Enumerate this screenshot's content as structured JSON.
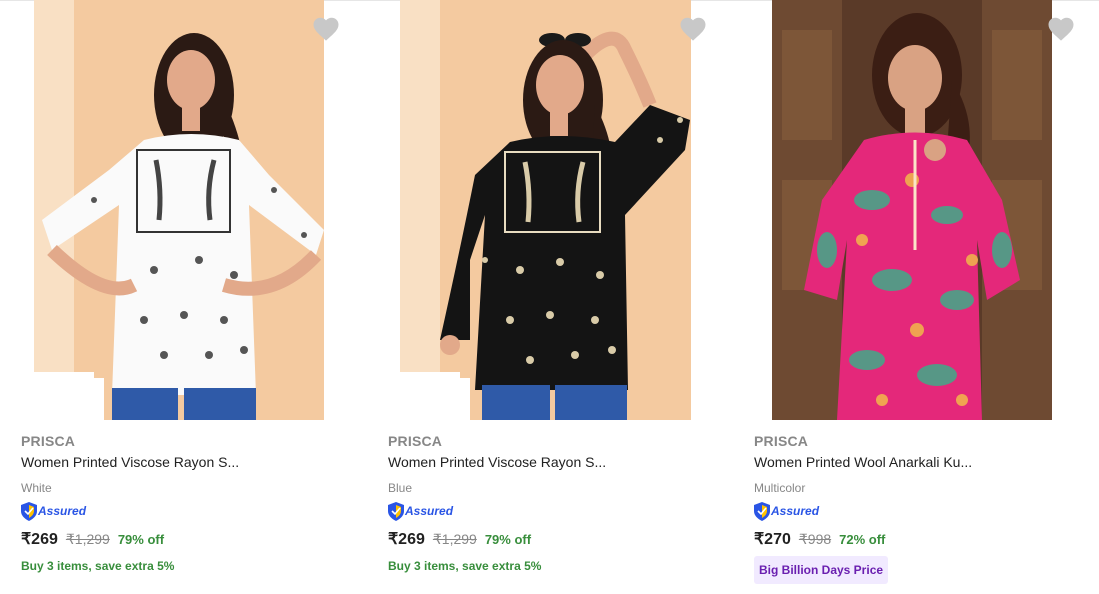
{
  "products": [
    {
      "brand": "PRISCA",
      "title": "Women Printed Viscose Rayon S...",
      "color": "White",
      "assured_label": "Assured",
      "price": "₹269",
      "mrp": "₹1,299",
      "discount": "79% off",
      "offer": "Buy 3 items, save extra 5%",
      "wishlist_icon": "heart-icon",
      "image_desc": "woman-in-white-embroidered-top"
    },
    {
      "brand": "PRISCA",
      "title": "Women Printed Viscose Rayon S...",
      "color": "Blue",
      "assured_label": "Assured",
      "price": "₹269",
      "mrp": "₹1,299",
      "discount": "79% off",
      "offer": "Buy 3 items, save extra 5%",
      "wishlist_icon": "heart-icon",
      "image_desc": "woman-in-black-embroidered-top"
    },
    {
      "brand": "PRISCA",
      "title": "Women Printed Wool Anarkali Ku...",
      "color": "Multicolor",
      "assured_label": "Assured",
      "price": "₹270",
      "mrp": "₹998",
      "discount": "72% off",
      "badge": "Big Billion Days Price",
      "wishlist_icon": "heart-icon",
      "image_desc": "woman-in-pink-paisley-kurta"
    }
  ],
  "colors": {
    "brand_grey": "#878787",
    "discount_green": "#388e3c",
    "assured_blue": "#2a55e5",
    "badge_bg": "#f1eaff",
    "badge_text": "#6a1fb0",
    "wishlist_grey": "#c8c8c8"
  }
}
